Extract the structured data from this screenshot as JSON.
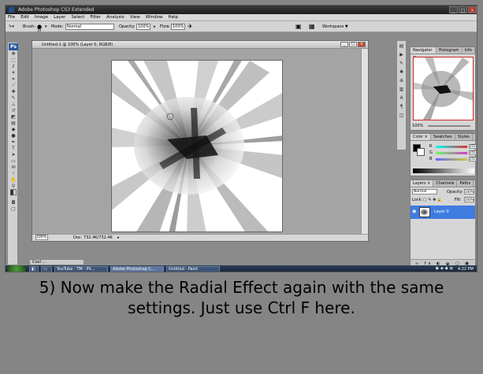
{
  "titlebar": {
    "title": "Adobe Photoshop CS3 Extended"
  },
  "menu": [
    "File",
    "Edit",
    "Image",
    "Layer",
    "Select",
    "Filter",
    "Analysis",
    "View",
    "Window",
    "Help"
  ],
  "options": {
    "brush_label": "Brush:",
    "brush_size": "19",
    "mode_label": "Mode:",
    "mode_value": "Normal",
    "opacity_label": "Opacity:",
    "opacity_value": "100%",
    "flow_label": "Flow:",
    "flow_value": "100%",
    "workspace_label": "Workspace ▼"
  },
  "document": {
    "title": "Untitled-1 @ 100% (Layer 0, RGB/8)",
    "zoom": "100%",
    "doc_info": "Doc: 732.4K/732.4K"
  },
  "navigator": {
    "tabs": [
      "Navigator ×",
      "Histogram",
      "Info"
    ],
    "zoom": "100%"
  },
  "color_panel": {
    "tabs": [
      "Color ×",
      "Swatches",
      "Styles"
    ],
    "channels": [
      {
        "label": "R",
        "value": "255",
        "color": "#e03030"
      },
      {
        "label": "G",
        "value": "255",
        "color": "#d33ac8"
      },
      {
        "label": "B",
        "value": "255",
        "color": "#c9c93a"
      }
    ]
  },
  "layers_panel": {
    "tabs": [
      "Layers ×",
      "Channels",
      "Paths"
    ],
    "blend_mode": "Normal",
    "opacity_label": "Opacity:",
    "opacity_value": "100%",
    "lock_label": "Lock:",
    "fill_label": "Fill:",
    "fill_value": "100%",
    "layer_name": "Layer 0"
  },
  "taskbar": {
    "items": [
      "Cool ...",
      "YouTube - TM - Ph...",
      "Adobe Photoshop C...",
      "Untitled - Paint"
    ],
    "clock": "4:22 PM"
  },
  "caption": {
    "line1": "5) Now make the Radial Effect again with the same",
    "line2": "settings. Just use Ctrl F here."
  },
  "colors": {
    "accent": "#3f7ce0",
    "taskbar": "#1b2a3d",
    "background": "#858585"
  }
}
